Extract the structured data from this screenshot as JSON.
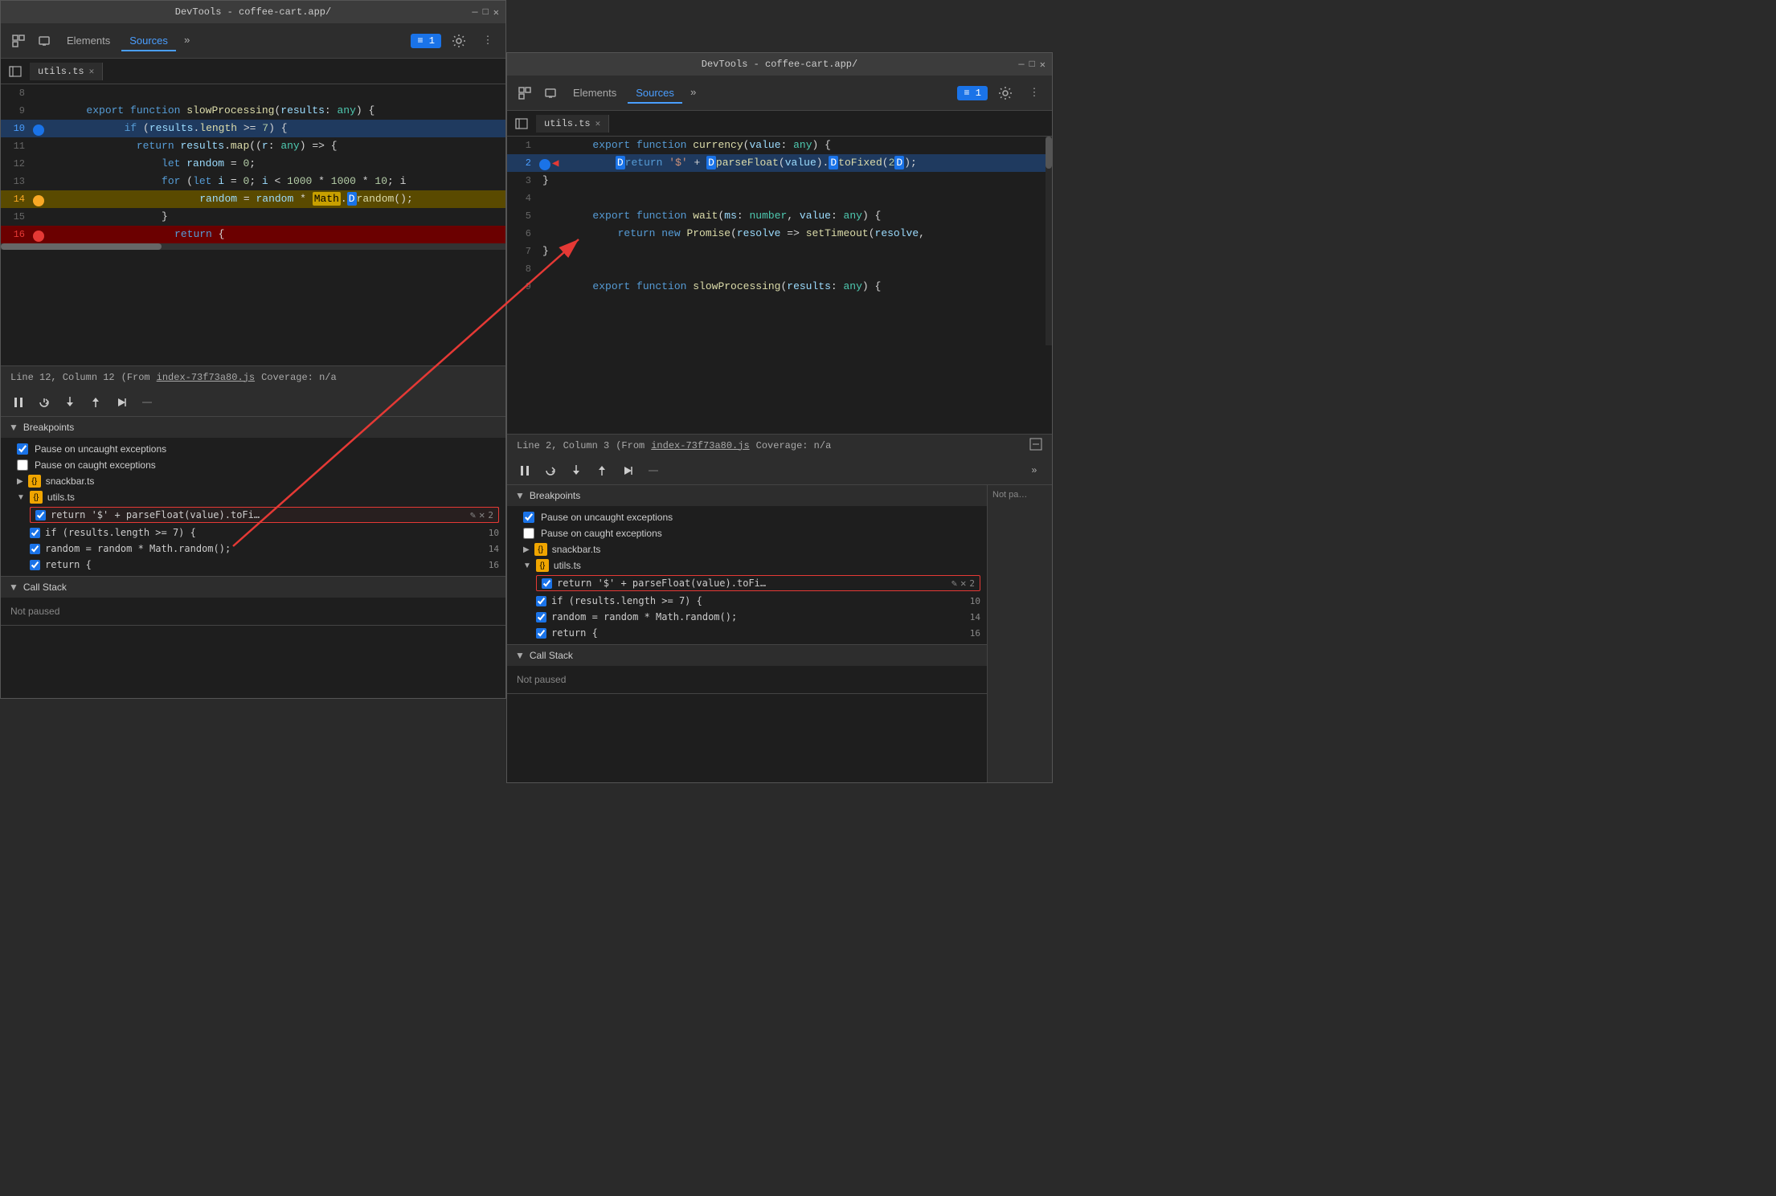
{
  "window1": {
    "title": "DevTools - coffee-cart.app/",
    "controls": [
      "—",
      "□",
      "✕"
    ],
    "tabs": [
      {
        "label": "Elements",
        "active": false
      },
      {
        "label": "Sources",
        "active": true
      },
      {
        "label": "»",
        "active": false
      }
    ],
    "console_badge": "≡ 1",
    "file_tab": "utils.ts",
    "code_lines": [
      {
        "num": "8",
        "content": "",
        "highlight": ""
      },
      {
        "num": "9",
        "content": "export function slowProcessing(results: any) {",
        "highlight": ""
      },
      {
        "num": "10",
        "content": "    if (results.length >= 7) {",
        "highlight": "blue"
      },
      {
        "num": "11",
        "content": "        return results.map((r: any) => {",
        "highlight": ""
      },
      {
        "num": "12",
        "content": "            let random = 0;",
        "highlight": ""
      },
      {
        "num": "13",
        "content": "            for (let i = 0; i < 1000 * 1000 * 10; i",
        "highlight": ""
      },
      {
        "num": "14",
        "content": "                random = random * Math.random();",
        "highlight": "yellow"
      },
      {
        "num": "15",
        "content": "            }",
        "highlight": ""
      },
      {
        "num": "16",
        "content": "            return {",
        "highlight": "red"
      }
    ],
    "status_bar": {
      "position": "Line 12, Column 12",
      "from_text": "(From",
      "file_link": "index-73f73a80.js",
      "coverage": "Coverage: n/a"
    },
    "debugger_toolbar": {
      "pause_btn": "⏸",
      "step_over": "↷",
      "step_into": "↓",
      "step_out": "↑",
      "continue": "⇒",
      "deactivate": "⊘"
    },
    "breakpoints_section": {
      "label": "Breakpoints",
      "pause_uncaught": "Pause on uncaught exceptions",
      "pause_uncaught_checked": true,
      "pause_caught": "Pause on caught exceptions",
      "pause_caught_checked": false,
      "snackbar_ts": "snackbar.ts",
      "utils_ts": "utils.ts",
      "bp_items": [
        {
          "code": "return '$' + parseFloat(value).toFi…",
          "line": "2",
          "highlighted": true
        },
        {
          "code": "if (results.length >= 7) {",
          "line": "10"
        },
        {
          "code": "random = random * Math.random();",
          "line": "14"
        },
        {
          "code": "return {",
          "line": "16"
        }
      ]
    },
    "call_stack": {
      "label": "Call Stack",
      "status": "Not paused"
    }
  },
  "window2": {
    "title": "DevTools - coffee-cart.app/",
    "controls": [
      "—",
      "□",
      "✕"
    ],
    "tabs": [
      {
        "label": "Elements",
        "active": false
      },
      {
        "label": "Sources",
        "active": true
      },
      {
        "label": "»",
        "active": false
      }
    ],
    "console_badge": "≡ 1",
    "file_tab": "utils.ts",
    "code_lines": [
      {
        "num": "1",
        "content": "export function currency(value: any) {",
        "highlight": ""
      },
      {
        "num": "2",
        "content": "    return '$' + parseFloat(value).toFixed(2);",
        "highlight": "blue"
      },
      {
        "num": "3",
        "content": "}",
        "highlight": ""
      },
      {
        "num": "4",
        "content": "",
        "highlight": ""
      },
      {
        "num": "5",
        "content": "export function wait(ms: number, value: any) {",
        "highlight": ""
      },
      {
        "num": "6",
        "content": "    return new Promise(resolve => setTimeout(resolve,",
        "highlight": ""
      },
      {
        "num": "7",
        "content": "}",
        "highlight": ""
      },
      {
        "num": "8",
        "content": "",
        "highlight": ""
      },
      {
        "num": "9",
        "content": "export function slowProcessing(results: any) {",
        "highlight": ""
      }
    ],
    "status_bar": {
      "position": "Line 2, Column 3",
      "from_text": "(From",
      "file_link": "index-73f73a80.js",
      "coverage": "Coverage: n/a"
    },
    "debugger_toolbar": {
      "pause_btn": "⏸",
      "step_over": "↷",
      "step_into": "↓",
      "step_out": "↑",
      "continue": "⇒",
      "deactivate": "⊘",
      "more": "»"
    },
    "right_panel_label": "Not pa…",
    "breakpoints_section": {
      "label": "Breakpoints",
      "pause_uncaught": "Pause on uncaught exceptions",
      "pause_uncaught_checked": true,
      "pause_caught": "Pause on caught exceptions",
      "pause_caught_checked": false,
      "snackbar_ts": "snackbar.ts",
      "utils_ts": "utils.ts",
      "bp_items": [
        {
          "code": "return '$' + parseFloat(value).toFi…",
          "line": "2",
          "highlighted": true
        },
        {
          "code": "if (results.length >= 7) {",
          "line": "10"
        },
        {
          "code": "random = random * Math.random();",
          "line": "14"
        },
        {
          "code": "return {",
          "line": "16"
        }
      ]
    },
    "call_stack": {
      "label": "Call Stack",
      "status": "Not paused"
    }
  }
}
